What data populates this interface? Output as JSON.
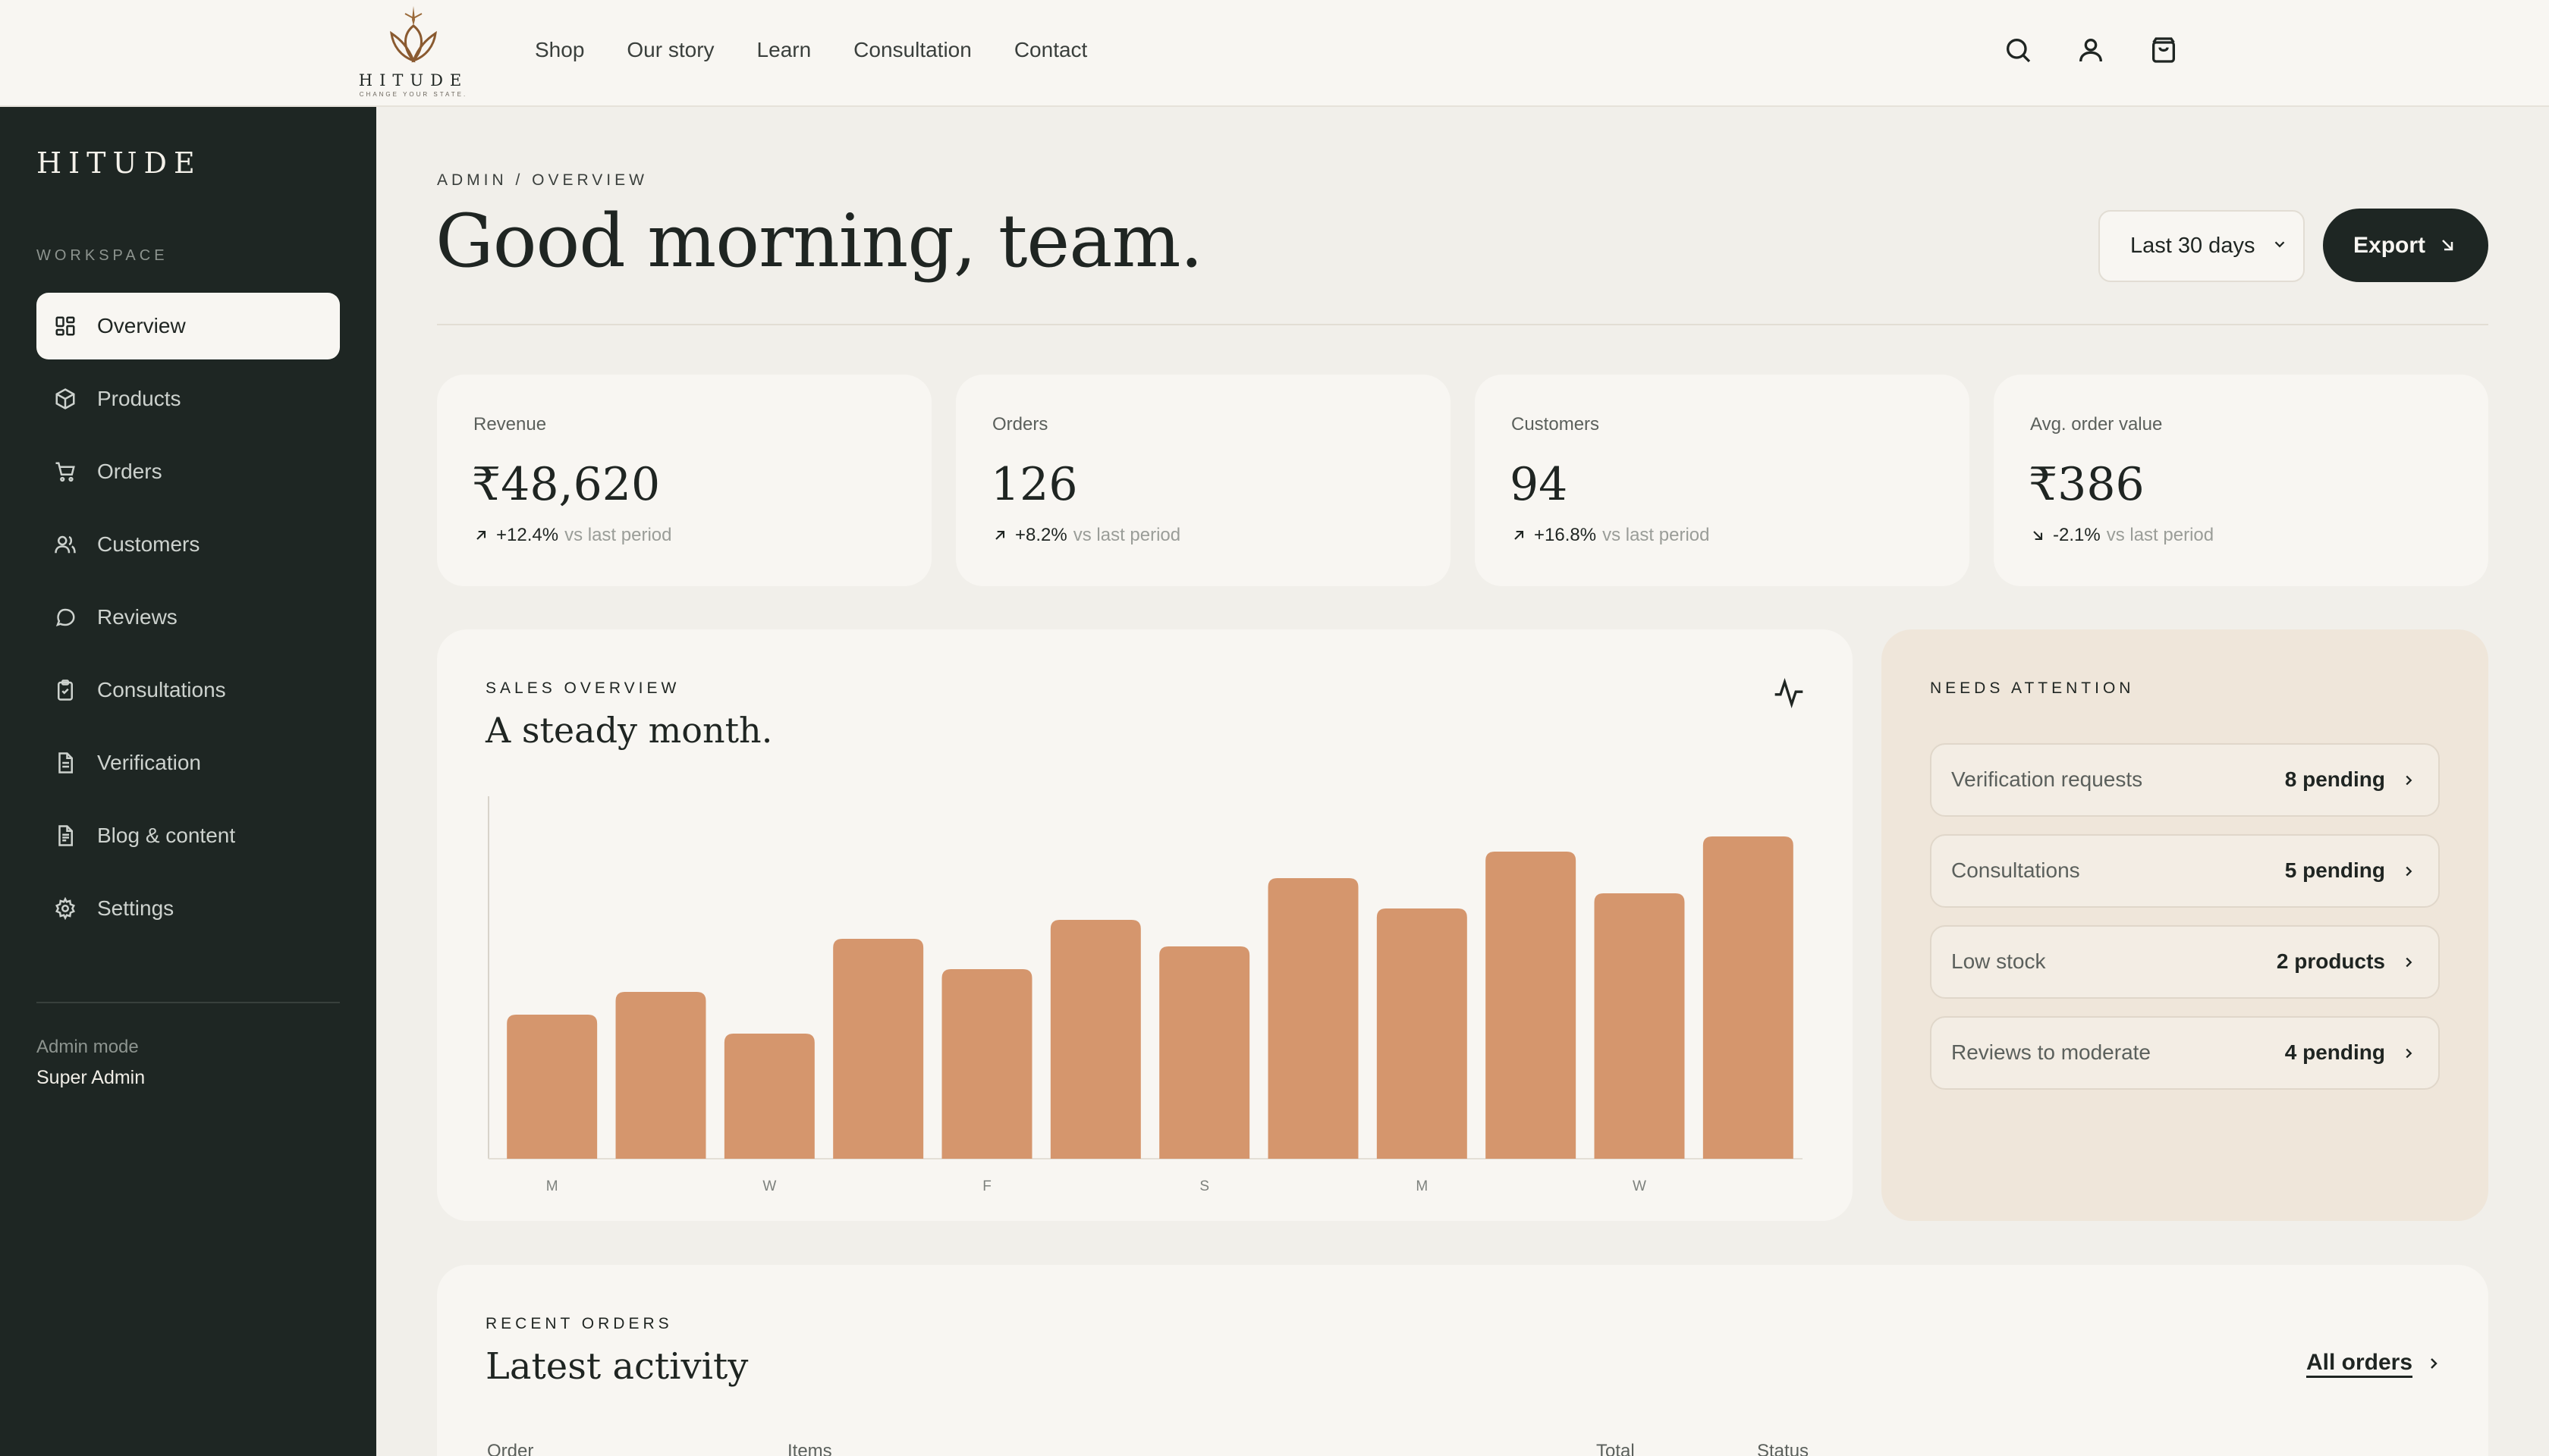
{
  "brand": {
    "logo_word": "HITUDE",
    "logo_tagline": "CHANGE YOUR STATE.",
    "sidebar_brand": "HITUDE"
  },
  "nav": {
    "links": [
      "Shop",
      "Our story",
      "Learn",
      "Consultation",
      "Contact"
    ]
  },
  "sidebar": {
    "section": "WORKSPACE",
    "items": [
      {
        "label": "Overview",
        "icon": "grid-icon",
        "active": true
      },
      {
        "label": "Products",
        "icon": "box-icon"
      },
      {
        "label": "Orders",
        "icon": "cart-icon"
      },
      {
        "label": "Customers",
        "icon": "users-icon"
      },
      {
        "label": "Reviews",
        "icon": "chat-icon"
      },
      {
        "label": "Consultations",
        "icon": "clipboard-icon"
      },
      {
        "label": "Verification",
        "icon": "document-icon"
      },
      {
        "label": "Blog & content",
        "icon": "file-text-icon"
      },
      {
        "label": "Settings",
        "icon": "gear-icon"
      }
    ],
    "mode_label": "Admin mode",
    "role": "Super Admin"
  },
  "header": {
    "breadcrumb": "ADMIN / OVERVIEW",
    "greeting": "Good morning, team.",
    "range": "Last 30 days",
    "export_label": "Export"
  },
  "stats": [
    {
      "label": "Revenue",
      "value": "₹48,620",
      "change": "+12.4%",
      "direction": "up",
      "compare": "vs last period"
    },
    {
      "label": "Orders",
      "value": "126",
      "change": "+8.2%",
      "direction": "up",
      "compare": "vs last period"
    },
    {
      "label": "Customers",
      "value": "94",
      "change": "+16.8%",
      "direction": "up",
      "compare": "vs last period"
    },
    {
      "label": "Avg. order value",
      "value": "₹386",
      "change": "-2.1%",
      "direction": "down",
      "compare": "vs last period"
    }
  ],
  "sales": {
    "eyebrow": "SALES OVERVIEW",
    "title": "A steady month."
  },
  "chart_data": {
    "type": "bar",
    "categories": [
      "M",
      "",
      "W",
      "",
      "F",
      "",
      "S",
      "",
      "M",
      "",
      "W",
      ""
    ],
    "values": [
      38,
      44,
      33,
      58,
      50,
      63,
      56,
      74,
      66,
      81,
      70,
      85
    ],
    "ylim": [
      0,
      100
    ],
    "bar_color": "#d5966d",
    "grid": false
  },
  "attention": {
    "eyebrow": "NEEDS ATTENTION",
    "items": [
      {
        "label": "Verification requests",
        "value": "8 pending"
      },
      {
        "label": "Consultations",
        "value": "5 pending"
      },
      {
        "label": "Low stock",
        "value": "2 products"
      },
      {
        "label": "Reviews to moderate",
        "value": "4 pending"
      }
    ]
  },
  "recent": {
    "eyebrow": "RECENT ORDERS",
    "title": "Latest activity",
    "all_label": "All orders",
    "columns": [
      "Order",
      "Items",
      "Total",
      "Status"
    ]
  },
  "colors": {
    "sidebar_bg": "#1e2623",
    "accent_bar": "#d5966d",
    "attention_bg": "#efe6da"
  }
}
